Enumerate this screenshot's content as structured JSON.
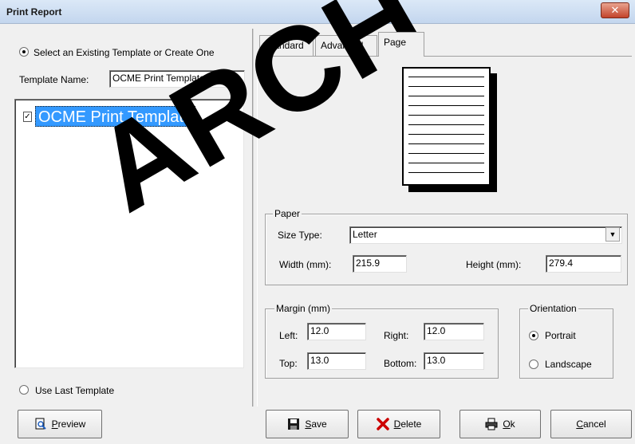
{
  "window": {
    "title": "Print Report",
    "close_glyph": "✕"
  },
  "left": {
    "radio_existing_label": "Select an Existing Template or Create One",
    "template_name_label": "Template Name:",
    "template_name_value": "OCME Print Template",
    "tree_item": "OCME Print Template",
    "radio_last_label": "Use Last Template"
  },
  "tabs": [
    {
      "label": "Standard"
    },
    {
      "label": "Advanced"
    },
    {
      "label": "Page"
    }
  ],
  "paper_group": {
    "legend": "Paper",
    "size_type_label": "Size Type:",
    "size_type_value": "Letter",
    "width_label": "Width (mm):",
    "width_value": "215.9",
    "height_label": "Height (mm):",
    "height_value": "279.4"
  },
  "margin_group": {
    "legend": "Margin (mm)",
    "left_label": "Left:",
    "left_value": "12.0",
    "right_label": "Right:",
    "right_value": "12.0",
    "top_label": "Top:",
    "top_value": "13.0",
    "bottom_label": "Bottom:",
    "bottom_value": "13.0"
  },
  "orientation_group": {
    "legend": "Orientation",
    "portrait_label": "Portrait",
    "landscape_label": "Landscape"
  },
  "buttons": {
    "preview_first": "P",
    "preview_rest": "review",
    "save_first": "S",
    "save_rest": "ave",
    "delete_first": "D",
    "delete_rest": "elete",
    "ok_first": "O",
    "ok_rest": "k",
    "cancel_first": "C",
    "cancel_rest": "ancel"
  },
  "watermark": "ARCH",
  "colors": {
    "selection": "#3399ff",
    "close_red": "#c2432b",
    "delete_red": "#cc0000"
  }
}
